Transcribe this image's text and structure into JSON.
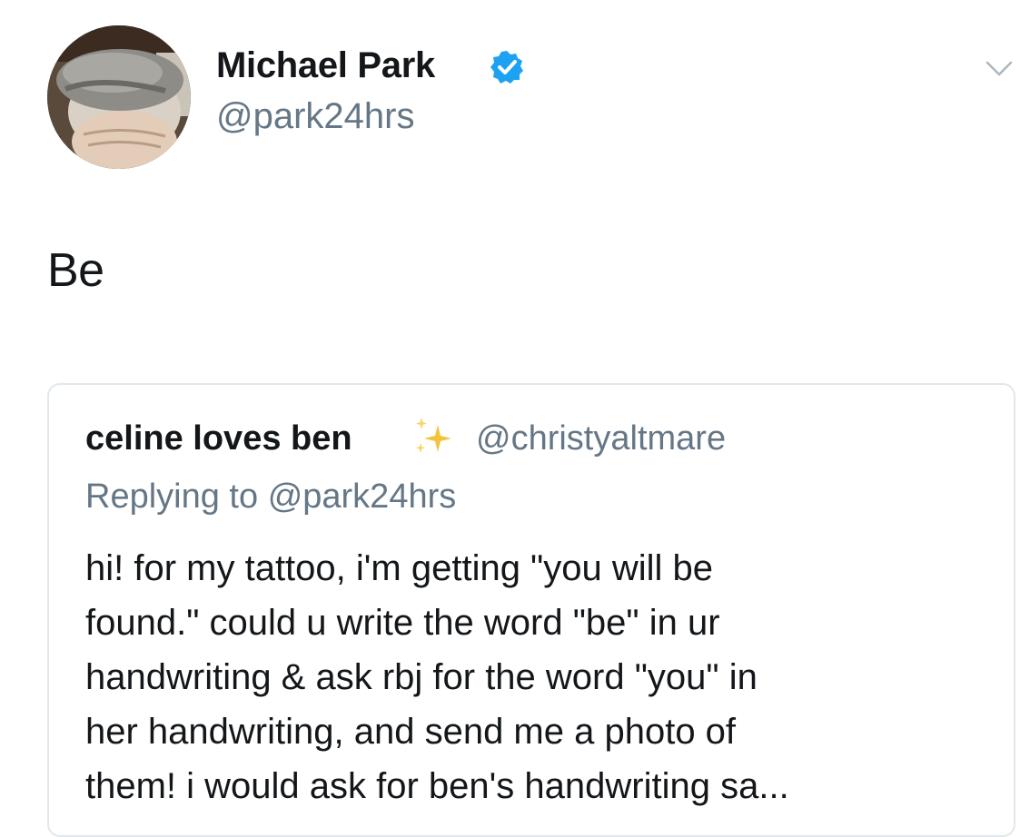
{
  "author": {
    "display_name": "Michael Park",
    "handle": "@park24hrs",
    "verified": true
  },
  "tweet": {
    "text": "Be"
  },
  "quoted_tweet": {
    "display_name": "celine loves ben",
    "name_emoji": "sparkles-icon",
    "handle": "@christyaltmare",
    "replying_prefix": "Replying to",
    "replying_handle": "@park24hrs",
    "lines": [
      "hi! for my tattoo, i'm getting \"you will be",
      "found.\" could u write the word \"be\" in ur",
      "handwriting & ask rbj for the word \"you\" in",
      "her handwriting, and send me a photo of",
      "them! i would ask for ben's handwriting sa..."
    ]
  },
  "icons": {
    "verified": "verified-badge-icon",
    "menu": "chevron-down-icon"
  },
  "colors": {
    "primary_text": "#14171a",
    "secondary_text": "#657786",
    "verified_blue": "#1da1f2",
    "card_border": "#e1e8ed",
    "sparkle_gold": "#f5c33b"
  }
}
